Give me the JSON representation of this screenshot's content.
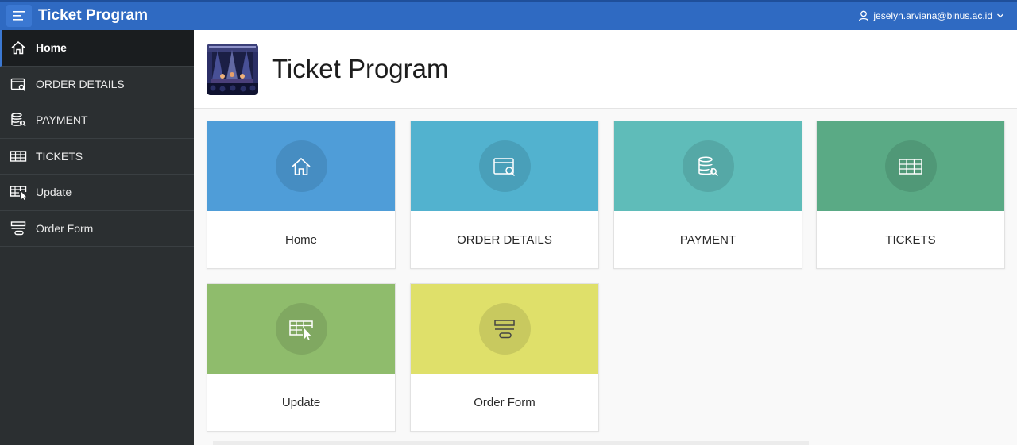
{
  "header": {
    "app_title": "Ticket Program",
    "user_email": "jeselyn.arviana@binus.ac.id",
    "brand_color": "#2f6ac2"
  },
  "sidebar": {
    "items": [
      {
        "label": "Home",
        "icon": "home-icon",
        "active": true
      },
      {
        "label": "ORDER DETAILS",
        "icon": "order-details-icon"
      },
      {
        "label": "PAYMENT",
        "icon": "payment-icon"
      },
      {
        "label": "TICKETS",
        "icon": "table-icon"
      },
      {
        "label": "Update",
        "icon": "table-cursor-icon"
      },
      {
        "label": "Order Form",
        "icon": "form-icon"
      }
    ]
  },
  "page": {
    "title": "Ticket Program",
    "hero_image": "concert-stage-image"
  },
  "cards": [
    {
      "label": "Home",
      "color": "#4f9dd8",
      "icon": "home-icon"
    },
    {
      "label": "ORDER DETAILS",
      "color": "#52b2cf",
      "icon": "order-details-icon"
    },
    {
      "label": "PAYMENT",
      "color": "#5fbcb9",
      "icon": "payment-icon"
    },
    {
      "label": "TICKETS",
      "color": "#5aaa85",
      "icon": "table-icon"
    },
    {
      "label": "Update",
      "color": "#8fbc6c",
      "icon": "table-cursor-icon"
    },
    {
      "label": "Order Form",
      "color": "#dfe06a",
      "icon": "form-icon"
    }
  ]
}
